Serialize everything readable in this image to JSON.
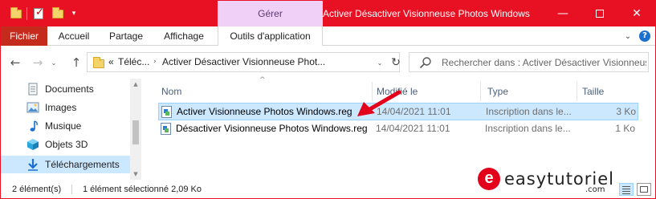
{
  "titlebar": {
    "manage_tab": "Gérer",
    "window_title": "Activer Désactiver Visionneuse Photos Windows",
    "colors": {
      "bar": "#e81123",
      "manage_tab_bg": "#f0d0f7"
    }
  },
  "ribbon": {
    "tabs": [
      "Fichier",
      "Accueil",
      "Partage",
      "Affichage",
      "Outils d'application"
    ]
  },
  "navbar": {
    "address": {
      "prefix": "«",
      "crumb_1": "Téléc...",
      "crumb_2": "Activer Désactiver Visionneuse Phot..."
    },
    "search_placeholder": "Rechercher dans : Activer Désactiver Visionneuse Photos Windows"
  },
  "sidebar": {
    "items": [
      {
        "label": "Documents",
        "icon": "documents-icon"
      },
      {
        "label": "Images",
        "icon": "images-icon"
      },
      {
        "label": "Musique",
        "icon": "music-icon"
      },
      {
        "label": "Objets 3D",
        "icon": "objects-3d-icon"
      },
      {
        "label": "Téléchargements",
        "icon": "downloads-icon",
        "selected": true
      }
    ]
  },
  "file_list": {
    "columns": [
      "Nom",
      "Modifié le",
      "Type",
      "Taille"
    ],
    "rows": [
      {
        "name": "Activer Visionneuse Photos Windows.reg",
        "modified": "14/04/2021 11:01",
        "type": "Inscription dans le...",
        "size": "3 Ko",
        "selected": true
      },
      {
        "name": "Désactiver Visionneuse Photos Windows.reg",
        "modified": "14/04/2021 11:01",
        "type": "Inscription dans le...",
        "size": "1 Ko",
        "selected": false
      }
    ]
  },
  "status": {
    "count": "2 élément(s)",
    "selection": "1 élément sélectionné  2,09 Ko"
  },
  "watermark": {
    "logo_letter": "e",
    "brand": "easytutoriel",
    "tld": ".com"
  }
}
